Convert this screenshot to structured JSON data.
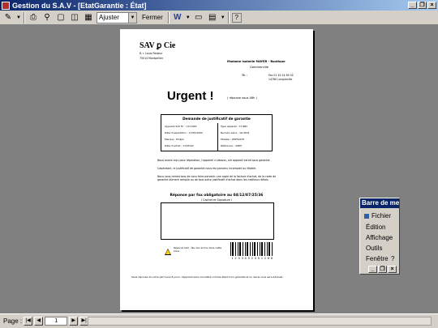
{
  "window": {
    "title": "Gestion du S.A.V - [EtatGarantie : État]"
  },
  "toolbar": {
    "zoom_value": "Ajuster",
    "close_label": "Fermer",
    "word_icon": "W",
    "help_icon": "?"
  },
  "report": {
    "company_name": "SAV ꝑ Cie",
    "company_line1": "8, r. Louis Pasteur",
    "company_line2": "75014 Montpellier",
    "client_line1": "Madame Isabelle MAYER - Boutique",
    "client_line2": "Gommerville",
    "tel_label": "Tél. :",
    "tel_value": "Fax 01 45 24 65 02",
    "client_line3": "14780 Longueville",
    "urgent_title": "Urgent !",
    "urgent_note": "( réponse sous 48h )",
    "warranty_title": "Demande de justificatif de garantie",
    "warranty_left": [
      "Appareil SAV N° : 19-1000",
      "Date d'expédition : 17/05/2005",
      "Marque : Philips",
      "Date d'achat : 17/05/02"
    ],
    "warranty_right": [
      "Type appareil : TV-BRI",
      "Numéro série : 19-4521",
      "Modèle : 28PT4478",
      "Référence : 44PH"
    ],
    "paragraphs": [
      "Nous avons reçu pour réparation, l'appareil ci-dessus, cet appareil serait sous garantie.",
      "Cependant, le justificatif de garantie nous est parvenu incomplet ou illisible.",
      "Nous vous remercions de nous faire parvenir une copie de la facture d'achat, de la carte de garantie dûment remplie ou de tout autre justificatif d'achat dans les meilleurs délais."
    ],
    "fax_title": "Réponse par fax obligatoire au 04/12/87/25/36",
    "fax_subtitle": "( Cachet et Signature )",
    "warning_text": "Réservé SAV - Ne rien écrire dans cette zone",
    "barcode_number": "1 2 0 3 4 0 2 0 0 1 2 6 8",
    "footer": "Sans réponse de votre part sous 8 jours, l'appareil sera considéré comme étant hors garantie et un devis vous sera adressé."
  },
  "status": {
    "page_label": "Page :",
    "page_number": "1"
  },
  "menu_panel": {
    "title": "Barre de menus",
    "items": [
      "Fichier",
      "Édition",
      "Affichage",
      "Outils",
      "Fenêtre",
      "?"
    ]
  }
}
